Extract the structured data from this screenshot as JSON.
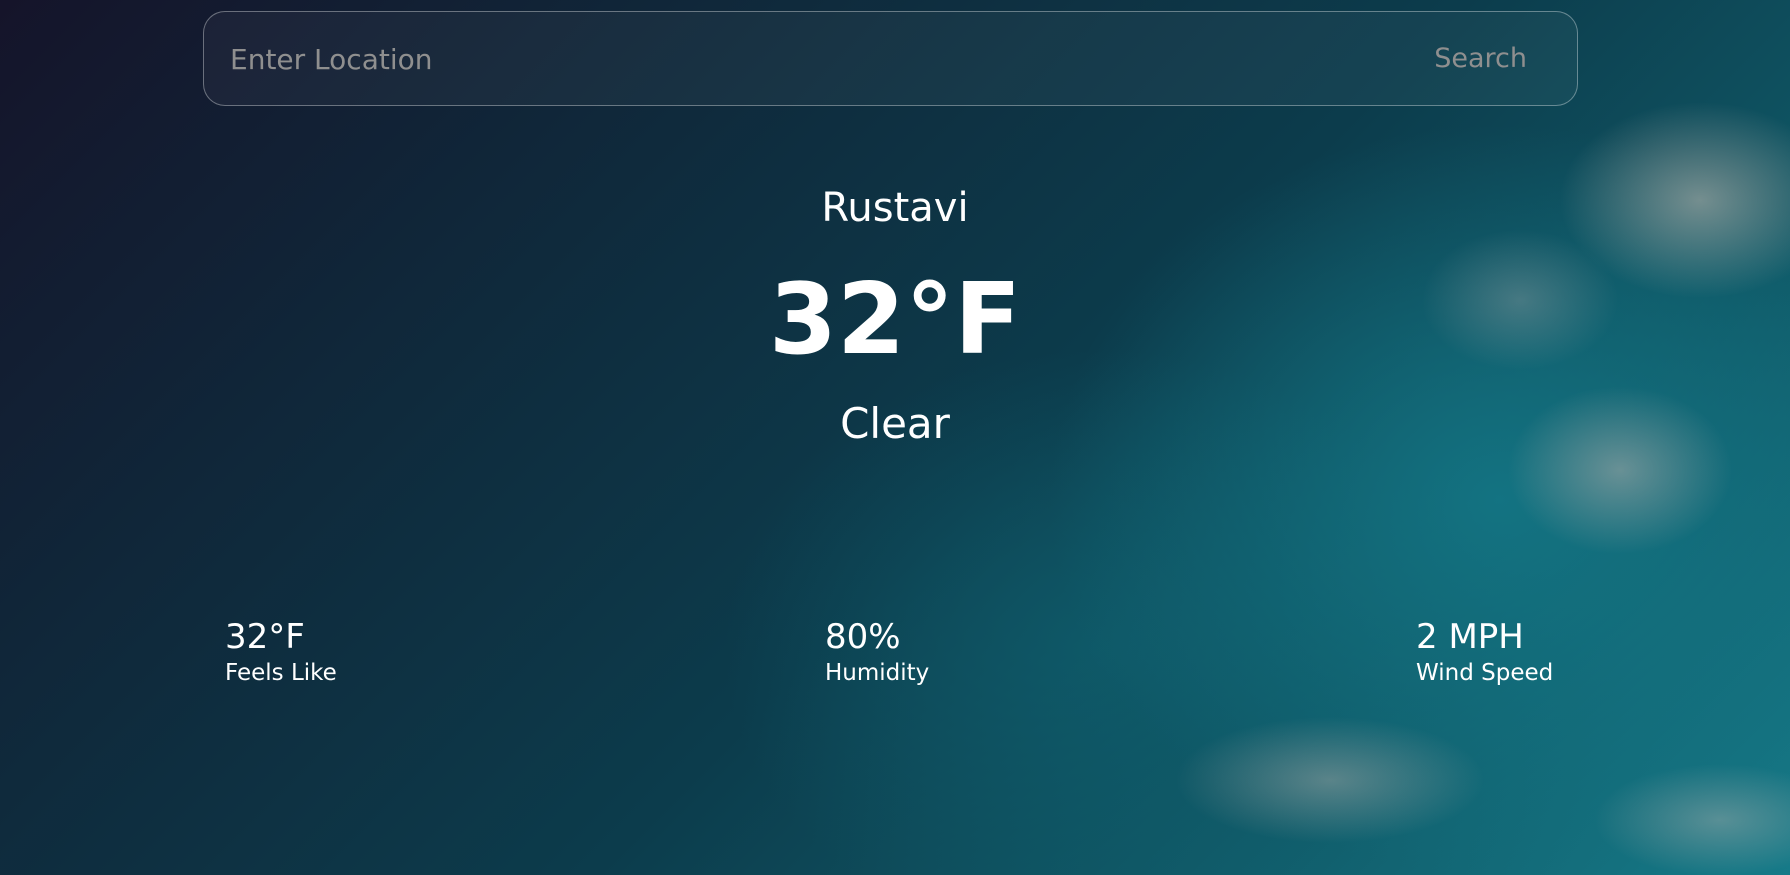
{
  "search": {
    "placeholder": "Enter Location",
    "value": "",
    "button_label": "Search"
  },
  "current": {
    "city": "Rustavi",
    "temperature": "32°F",
    "condition": "Clear"
  },
  "stats": {
    "feels_like": {
      "value": "32°F",
      "label": "Feels Like"
    },
    "humidity": {
      "value": "80%",
      "label": "Humidity"
    },
    "wind_speed": {
      "value": "2 MPH",
      "label": "Wind Speed"
    }
  },
  "colors": {
    "text": "#ffffff",
    "placeholder": "#8f8f8f",
    "background_dark": "#15142a",
    "background_teal": "#167a88"
  }
}
